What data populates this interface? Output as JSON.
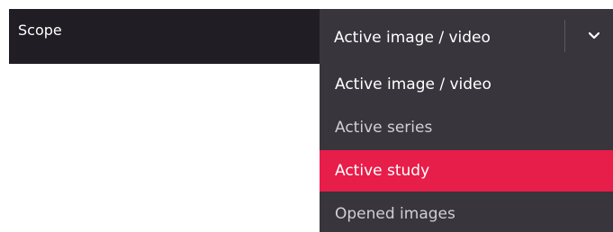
{
  "field": {
    "label": "Scope"
  },
  "select": {
    "value": "Active image / video",
    "chevron_icon": "chevron-down-icon"
  },
  "menu": {
    "items": [
      {
        "label": "Active image / video",
        "state": "selected"
      },
      {
        "label": "Active series",
        "state": "normal"
      },
      {
        "label": "Active study",
        "state": "highlighted"
      },
      {
        "label": "Opened images",
        "state": "normal"
      }
    ]
  },
  "colors": {
    "row_bg": "#201d24",
    "select_bg": "#38353c",
    "highlight": "#e71d4a",
    "text": "#ffffff",
    "muted_text": "#d0cfd3"
  }
}
